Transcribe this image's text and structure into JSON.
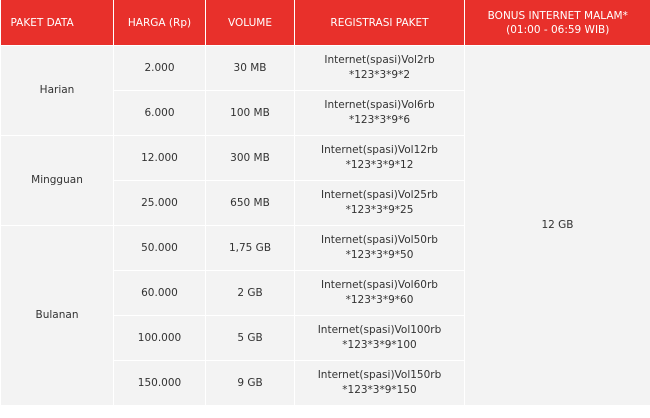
{
  "table": {
    "headers": [
      "PAKET DATA",
      "HARGA (Rp)",
      "VOLUME",
      "REGISTRASI PAKET",
      "BONUS INTERNET MALAM*",
      "(01:00 - 06:59 WIB)"
    ],
    "groups": [
      {
        "name": "Harian",
        "rows": [
          {
            "harga": "2.000",
            "volume": "30 MB",
            "reg1": "Internet(spasi)Vol2rb",
            "reg2": "*123*3*9*2"
          },
          {
            "harga": "6.000",
            "volume": "100 MB",
            "reg1": "Internet(spasi)Vol6rb",
            "reg2": "*123*3*9*6"
          }
        ]
      },
      {
        "name": "Mingguan",
        "rows": [
          {
            "harga": "12.000",
            "volume": "300 MB",
            "reg1": "Internet(spasi)Vol12rb",
            "reg2": "*123*3*9*12"
          },
          {
            "harga": "25.000",
            "volume": "650 MB",
            "reg1": "Internet(spasi)Vol25rb",
            "reg2": "*123*3*9*25"
          }
        ]
      },
      {
        "name": "Bulanan",
        "rows": [
          {
            "harga": "50.000",
            "volume": "1,75 GB",
            "reg1": "Internet(spasi)Vol50rb",
            "reg2": "*123*3*9*50"
          },
          {
            "harga": "60.000",
            "volume": "2 GB",
            "reg1": "Internet(spasi)Vol60rb",
            "reg2": "*123*3*9*60"
          },
          {
            "harga": "100.000",
            "volume": "5 GB",
            "reg1": "Internet(spasi)Vol100rb",
            "reg2": "*123*3*9*100"
          },
          {
            "harga": "150.000",
            "volume": "9 GB",
            "reg1": "Internet(spasi)Vol150rb",
            "reg2": "*123*3*9*150"
          }
        ]
      }
    ],
    "bonus": "12 GB"
  },
  "colors": {
    "header_bg": "#e8302b",
    "cell_bg": "#f3f3f3"
  }
}
